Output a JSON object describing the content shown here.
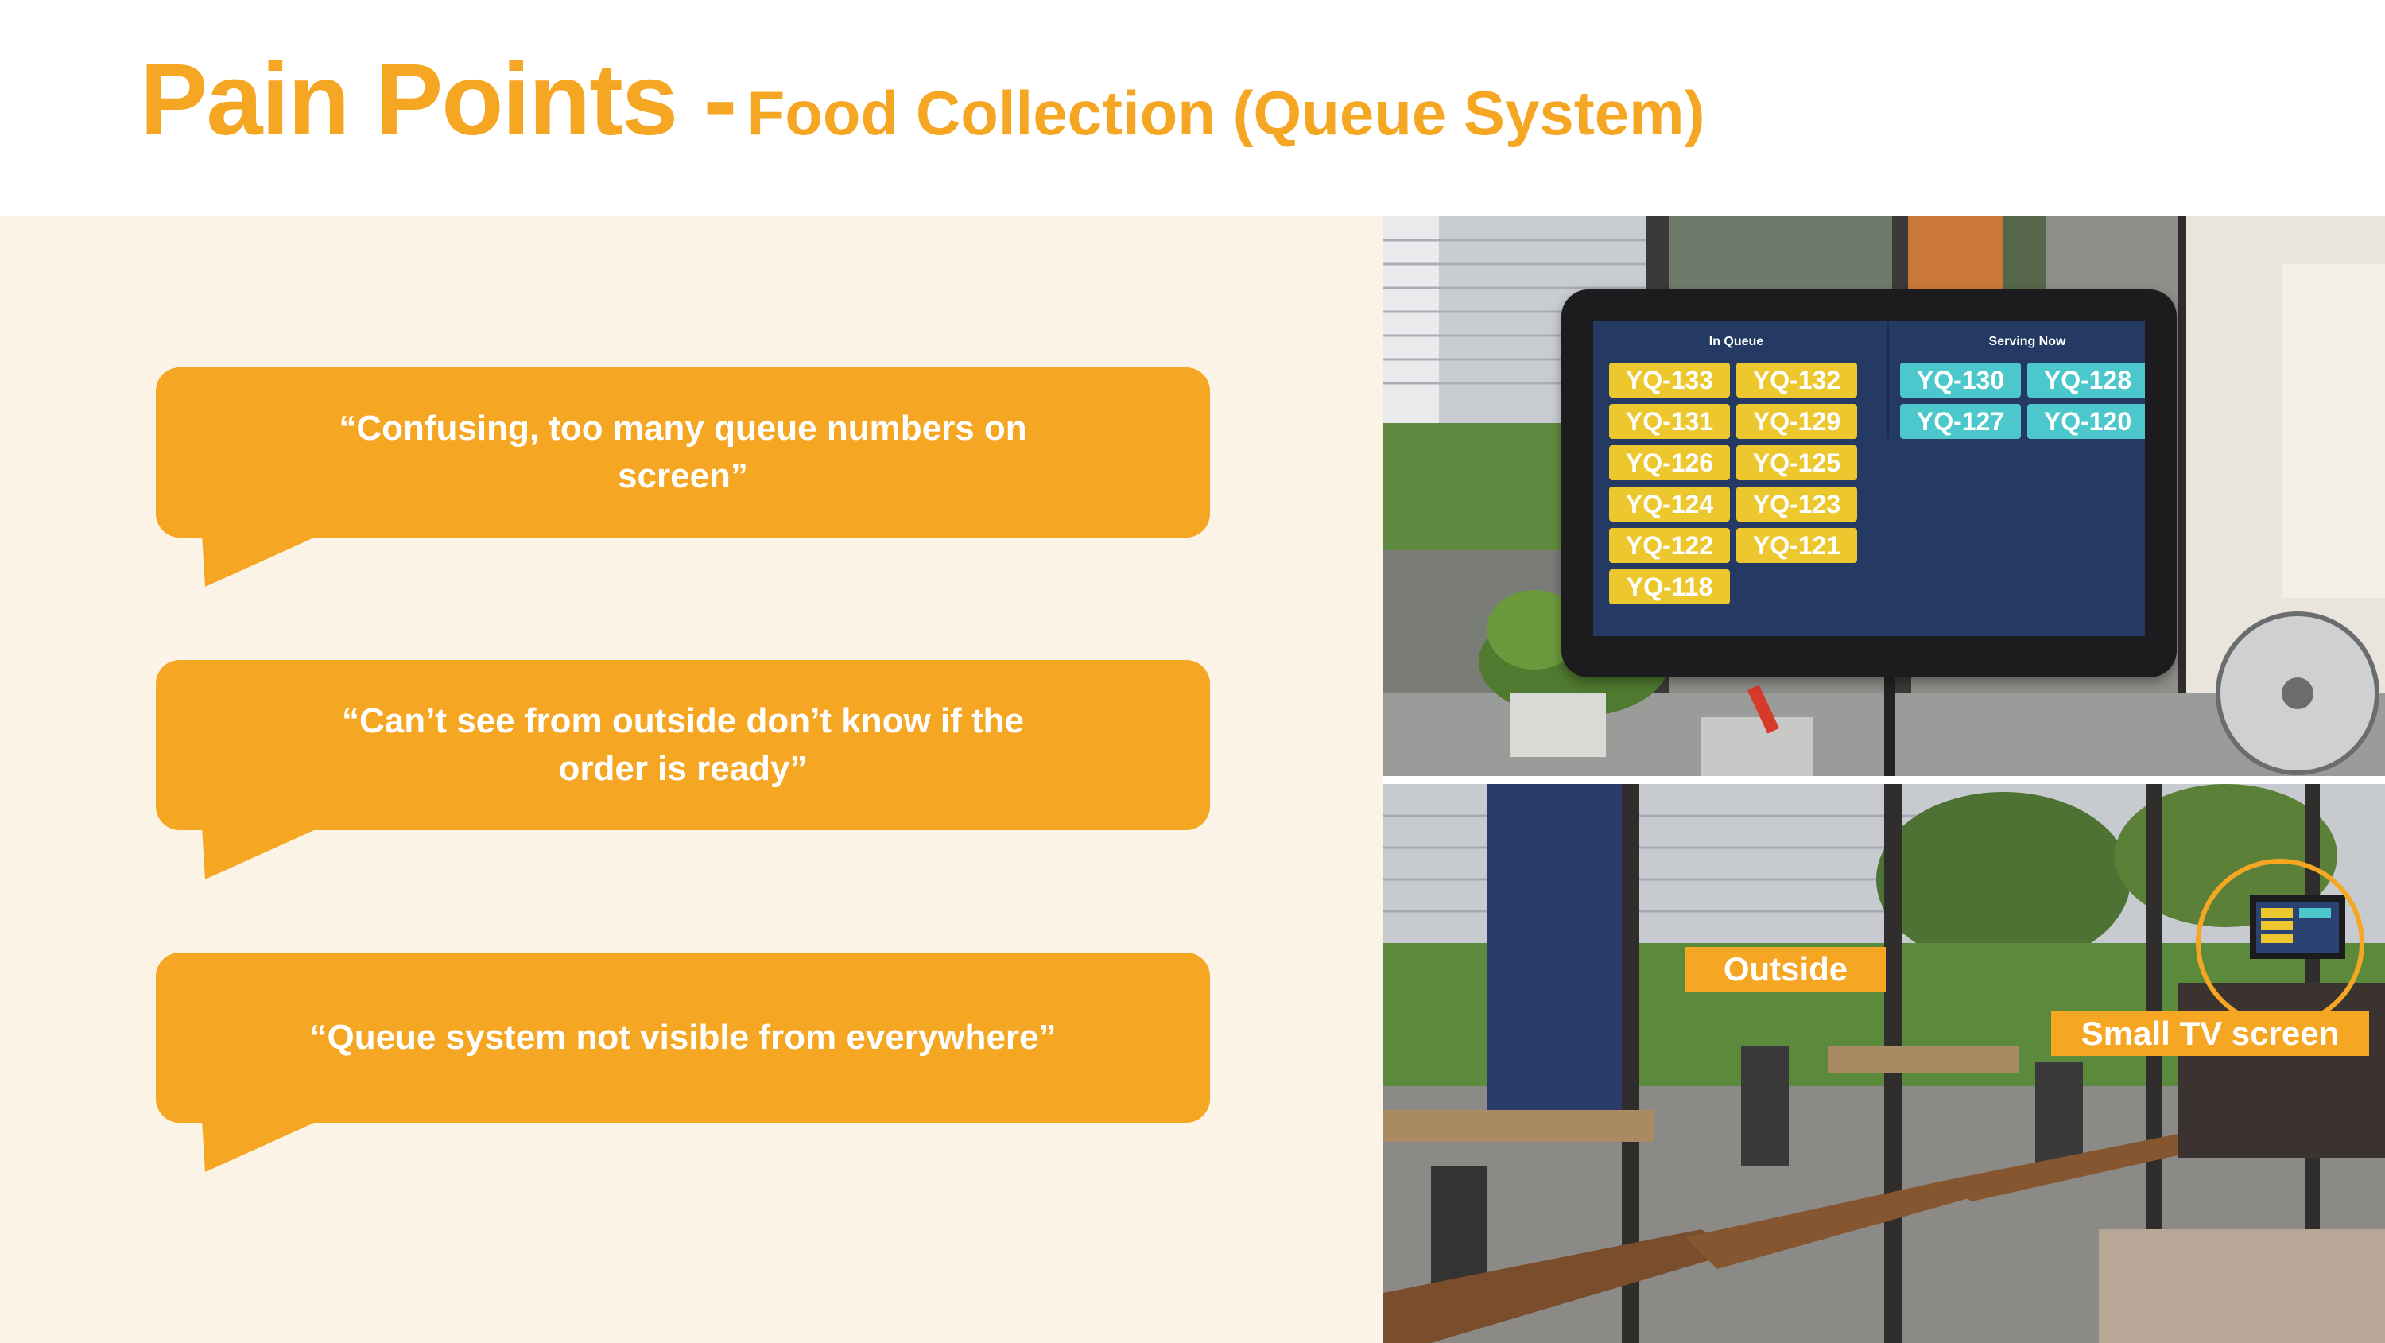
{
  "slide": {
    "title_main": "Pain Points -",
    "title_sub": "Food Collection (Queue System)"
  },
  "quotes": [
    "“Confusing, too many queue numbers on screen”",
    "“Can’t see from outside don’t know if the order is ready”",
    "“Queue system not visible from everywhere”"
  ],
  "queue_screen": {
    "in_queue_title": "In Queue",
    "serving_title": "Serving Now",
    "in_queue": [
      "YQ-133",
      "YQ-132",
      "YQ-131",
      "YQ-129",
      "YQ-126",
      "YQ-125",
      "YQ-124",
      "YQ-123",
      "YQ-122",
      "YQ-121",
      "YQ-118"
    ],
    "serving_now": [
      "YQ-130",
      "YQ-128",
      "YQ-127",
      "YQ-120"
    ]
  },
  "photo_labels": {
    "outside": "Outside",
    "tv": "Small TV screen"
  },
  "colors": {
    "accent": "#f5a623",
    "panel_bg": "#fcf3e7",
    "queue_yellow": "#ecc82e",
    "serving_teal": "#4cc8cc"
  }
}
